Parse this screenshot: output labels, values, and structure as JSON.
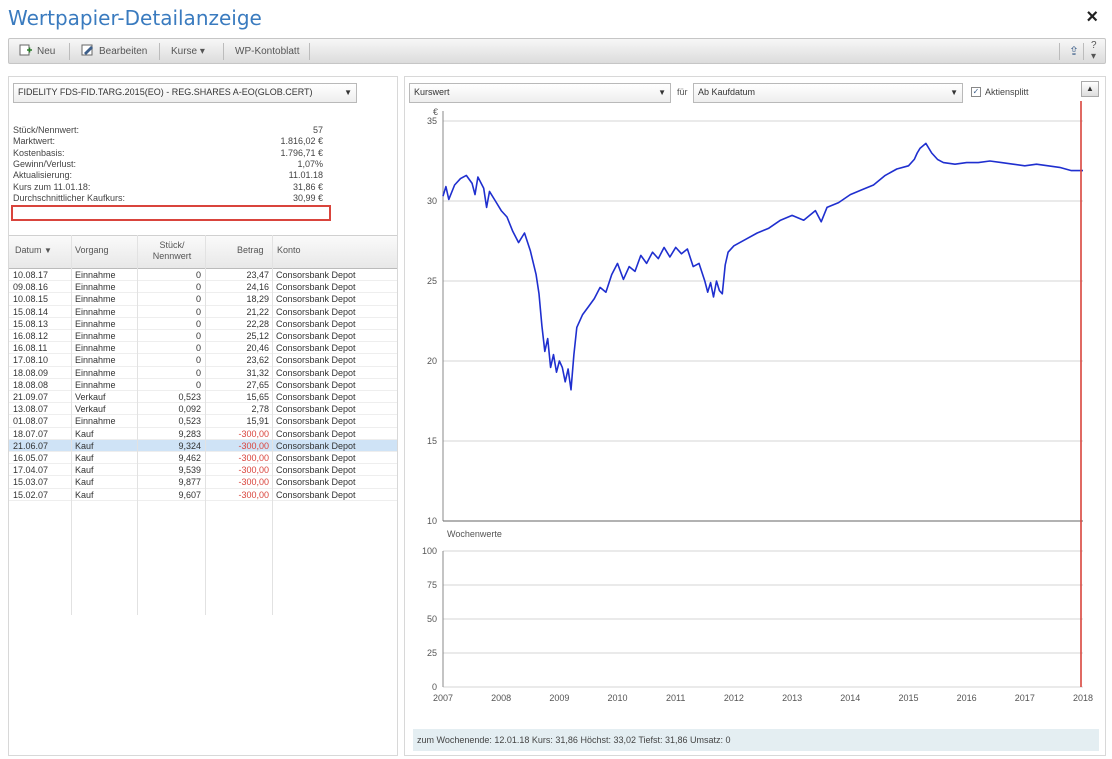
{
  "window": {
    "title": "Wertpapier-Detailanzeige",
    "close": "×"
  },
  "toolbar": {
    "new_label": "Neu",
    "edit_label": "Bearbeiten",
    "prices_label": "Kurse ▾",
    "sheet_label": "WP-Kontoblatt",
    "export_label": "⇪",
    "help_label": "? ▾"
  },
  "security": {
    "selected": "FIDELITY FDS-FID.TARG.2015(EO) - REG.SHARES A-EO(GLOB.CERT)"
  },
  "info": [
    {
      "label": "Stück/Nennwert:",
      "value": "57"
    },
    {
      "label": "Marktwert:",
      "value": "1.816,02 €"
    },
    {
      "label": "Kostenbasis:",
      "value": "1.796,71 €"
    },
    {
      "label": "Gewinn/Verlust:",
      "value": "1,07%"
    },
    {
      "label": "Aktualisierung:",
      "value": "11.01.18"
    },
    {
      "label": "Kurs zum 11.01.18:",
      "value": "31,86 €"
    },
    {
      "label": "Durchschnittlicher Kaufkurs:",
      "value": "30,99 €"
    }
  ],
  "table": {
    "headers": {
      "date": "Datum",
      "process": "Vorgang",
      "units": "Stück/\nNennwert",
      "amount": "Betrag",
      "account": "Konto"
    },
    "rows": [
      {
        "date": "10.08.17",
        "process": "Einnahme",
        "units": "0",
        "amount": "23,47",
        "account": "Consorsbank Depot"
      },
      {
        "date": "09.08.16",
        "process": "Einnahme",
        "units": "0",
        "amount": "24,16",
        "account": "Consorsbank Depot"
      },
      {
        "date": "10.08.15",
        "process": "Einnahme",
        "units": "0",
        "amount": "18,29",
        "account": "Consorsbank Depot"
      },
      {
        "date": "15.08.14",
        "process": "Einnahme",
        "units": "0",
        "amount": "21,22",
        "account": "Consorsbank Depot"
      },
      {
        "date": "15.08.13",
        "process": "Einnahme",
        "units": "0",
        "amount": "22,28",
        "account": "Consorsbank Depot"
      },
      {
        "date": "16.08.12",
        "process": "Einnahme",
        "units": "0",
        "amount": "25,12",
        "account": "Consorsbank Depot"
      },
      {
        "date": "16.08.11",
        "process": "Einnahme",
        "units": "0",
        "amount": "20,46",
        "account": "Consorsbank Depot"
      },
      {
        "date": "17.08.10",
        "process": "Einnahme",
        "units": "0",
        "amount": "23,62",
        "account": "Consorsbank Depot"
      },
      {
        "date": "18.08.09",
        "process": "Einnahme",
        "units": "0",
        "amount": "31,32",
        "account": "Consorsbank Depot"
      },
      {
        "date": "18.08.08",
        "process": "Einnahme",
        "units": "0",
        "amount": "27,65",
        "account": "Consorsbank Depot"
      },
      {
        "date": "21.09.07",
        "process": "Verkauf",
        "units": "0,523",
        "amount": "15,65",
        "account": "Consorsbank Depot"
      },
      {
        "date": "13.08.07",
        "process": "Verkauf",
        "units": "0,092",
        "amount": "2,78",
        "account": "Consorsbank Depot"
      },
      {
        "date": "01.08.07",
        "process": "Einnahme",
        "units": "0,523",
        "amount": "15,91",
        "account": "Consorsbank Depot"
      },
      {
        "date": "18.07.07",
        "process": "Kauf",
        "units": "9,283",
        "amount": "-300,00",
        "account": "Consorsbank Depot"
      },
      {
        "date": "21.06.07",
        "process": "Kauf",
        "units": "9,324",
        "amount": "-300,00",
        "account": "Consorsbank Depot"
      },
      {
        "date": "16.05.07",
        "process": "Kauf",
        "units": "9,462",
        "amount": "-300,00",
        "account": "Consorsbank Depot"
      },
      {
        "date": "17.04.07",
        "process": "Kauf",
        "units": "9,539",
        "amount": "-300,00",
        "account": "Consorsbank Depot"
      },
      {
        "date": "15.03.07",
        "process": "Kauf",
        "units": "9,877",
        "amount": "-300,00",
        "account": "Consorsbank Depot"
      },
      {
        "date": "15.02.07",
        "process": "Kauf",
        "units": "9,607",
        "amount": "-300,00",
        "account": "Consorsbank Depot"
      }
    ],
    "selected_index": 14
  },
  "chart_controls": {
    "metric": "Kurswert",
    "for_label": "für",
    "range": "Ab Kaufdatum",
    "split_label": "Aktiensplitt",
    "split_checked": "✓",
    "scroll_label": "▲"
  },
  "colors": {
    "line": "#1f2fcf",
    "marker": "#d9443c",
    "accent": "#3a7bbf",
    "negative": "#d9443c"
  },
  "chart_data": [
    {
      "type": "line",
      "ylabel": "€",
      "ylim": [
        10,
        35
      ],
      "yticks": [
        10,
        15,
        20,
        25,
        30,
        35
      ],
      "xlim": [
        2007,
        2018
      ],
      "xticks": [
        2007,
        2008,
        2009,
        2010,
        2011,
        2012,
        2013,
        2014,
        2015,
        2016,
        2017,
        2018
      ],
      "grid": true,
      "series": [
        {
          "x": [
            2007.0,
            2007.05,
            2007.1,
            2007.2,
            2007.3,
            2007.4,
            2007.5,
            2007.55,
            2007.6,
            2007.7,
            2007.75,
            2007.8,
            2007.9,
            2008.0,
            2008.1,
            2008.2,
            2008.3,
            2008.4,
            2008.5,
            2008.6,
            2008.65,
            2008.7,
            2008.75,
            2008.8,
            2008.85,
            2008.9,
            2008.95,
            2009.0,
            2009.05,
            2009.1,
            2009.15,
            2009.2,
            2009.25,
            2009.3,
            2009.4,
            2009.5,
            2009.6,
            2009.7,
            2009.8,
            2009.9,
            2010.0,
            2010.1,
            2010.2,
            2010.3,
            2010.4,
            2010.5,
            2010.6,
            2010.7,
            2010.8,
            2010.9,
            2011.0,
            2011.1,
            2011.2,
            2011.3,
            2011.4,
            2011.5,
            2011.55,
            2011.6,
            2011.65,
            2011.7,
            2011.75,
            2011.8,
            2011.85,
            2011.9,
            2012.0,
            2012.2,
            2012.4,
            2012.6,
            2012.8,
            2013.0,
            2013.2,
            2013.4,
            2013.5,
            2013.6,
            2013.8,
            2014.0,
            2014.2,
            2014.4,
            2014.6,
            2014.8,
            2015.0,
            2015.1,
            2015.15,
            2015.2,
            2015.3,
            2015.4,
            2015.5,
            2015.6,
            2015.8,
            2016.0,
            2016.2,
            2016.4,
            2016.6,
            2016.8,
            2017.0,
            2017.2,
            2017.4,
            2017.6,
            2017.8,
            2018.0
          ],
          "y": [
            30.3,
            30.9,
            30.1,
            31.0,
            31.4,
            31.6,
            31.1,
            30.4,
            31.5,
            30.8,
            29.6,
            30.6,
            30.0,
            29.4,
            29.0,
            28.1,
            27.4,
            28.0,
            26.9,
            25.4,
            24.2,
            22.2,
            20.6,
            21.4,
            19.6,
            20.4,
            19.3,
            20.0,
            19.6,
            18.7,
            19.5,
            18.2,
            20.4,
            22.1,
            22.9,
            23.4,
            23.9,
            24.6,
            24.3,
            25.4,
            26.1,
            25.1,
            25.9,
            25.6,
            26.6,
            26.1,
            26.8,
            26.4,
            27.1,
            26.5,
            27.1,
            26.7,
            27.0,
            25.9,
            26.1,
            25.0,
            24.3,
            24.9,
            24.0,
            25.0,
            24.4,
            24.2,
            26.0,
            26.8,
            27.2,
            27.6,
            28.0,
            28.3,
            28.8,
            29.1,
            28.8,
            29.4,
            28.7,
            29.6,
            29.9,
            30.4,
            30.7,
            31.0,
            31.6,
            32.0,
            32.2,
            32.6,
            33.0,
            33.3,
            33.6,
            33.0,
            32.6,
            32.4,
            32.3,
            32.4,
            32.4,
            32.5,
            32.4,
            32.3,
            32.2,
            32.3,
            32.2,
            32.1,
            31.9,
            31.9
          ]
        }
      ]
    },
    {
      "type": "line",
      "title": "Wochenwerte",
      "ylim": [
        0,
        100
      ],
      "yticks": [
        0,
        25,
        50,
        75,
        100
      ],
      "xlim": [
        2007,
        2018
      ],
      "grid": true,
      "series": []
    }
  ],
  "status": {
    "text": "zum Wochenende: 12.01.18  Kurs: 31,86  Höchst: 33,02  Tiefst: 31,86  Umsatz: 0"
  }
}
